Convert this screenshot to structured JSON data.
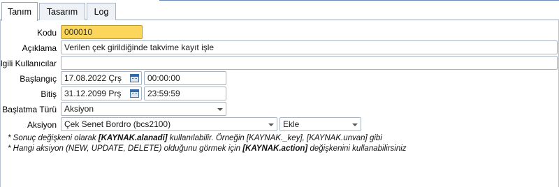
{
  "tabs": [
    "Tanım",
    "Tasarım",
    "Log"
  ],
  "form": {
    "kodu_label": "Kodu",
    "kodu_value": "000010",
    "aciklama_label": "Açıklama",
    "aciklama_value": "Verilen çek girildiğinde takvime kayıt işle",
    "ilgili_label": "İlgili Kullanıcılar",
    "ilgili_value": "",
    "baslangic_label": "Başlangıç",
    "baslangic_date": "17.08.2022 Çrş",
    "baslangic_time": "00:00:00",
    "bitis_label": "Bitiş",
    "bitis_date": "31.12.2099 Prş",
    "bitis_time": "23:59:59",
    "baslatma_label": "Başlatma Türü",
    "baslatma_value": "Aksiyon",
    "aksiyon_label": "Aksiyon",
    "aksiyon_value": "Çek Senet Bordro (bcs2100)",
    "mode_value": "Ekle"
  },
  "notes": {
    "line1_a": "* Sonuç değişkeni olarak ",
    "line1_b": "[KAYNAK.alanadi]",
    "line1_c": " kullanılabilir. Örneğin [KAYNAK._key], [KAYNAK.unvan] gibi",
    "line2_a": "* Hangi aksiyon (NEW, UPDATE, DELETE) olduğunu görmek için ",
    "line2_b": "[KAYNAK.action]",
    "line2_c": " değişkenini kullanabilirsiniz"
  }
}
